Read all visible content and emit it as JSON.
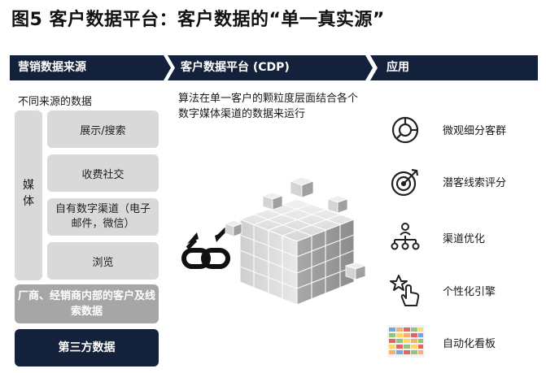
{
  "title": "图5 客户数据平台：客户数据的“单一真实源”",
  "columns": {
    "sources": "营销数据来源",
    "cdp": "客户数据平台 (CDP)",
    "applications": "应用"
  },
  "sources": {
    "label": "不同来源的数据",
    "media_label": "媒体",
    "channels": [
      "展示/搜索",
      "收费社交",
      "自有数字渠道（电子邮件，微信）",
      "浏览"
    ],
    "dealer": "厂商、经销商内部的客户及线索数据",
    "third_party": "第三方数据"
  },
  "cdp": {
    "description": "算法在单一客户的颗粒度层面结合各个数字媒体渠道的数据来运行"
  },
  "applications": [
    {
      "icon": "pie-chart-icon",
      "label": "微观细分客群"
    },
    {
      "icon": "target-icon",
      "label": "潜客线索评分"
    },
    {
      "icon": "network-icon",
      "label": "渠道优化"
    },
    {
      "icon": "hand-click-icon",
      "label": "个性化引擎"
    },
    {
      "icon": "dashboard-heatmap-icon",
      "label": "自动化看板"
    }
  ],
  "colors": {
    "navy": "#14213a",
    "light_gray": "#d9d9d9",
    "mid_gray": "#a6a6a6"
  }
}
